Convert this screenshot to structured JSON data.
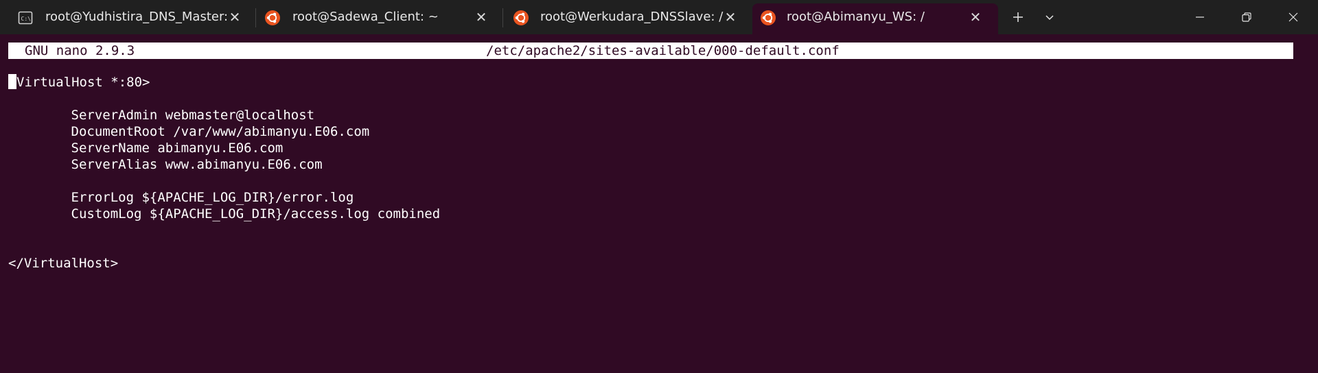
{
  "tabs": [
    {
      "title": "root@Yudhistira_DNS_Master:",
      "icon": "cmd-icon",
      "active": false
    },
    {
      "title": "root@Sadewa_Client: ~",
      "icon": "ubuntu-icon",
      "active": false
    },
    {
      "title": "root@Werkudara_DNSSlave: /",
      "icon": "ubuntu-icon",
      "active": false
    },
    {
      "title": "root@Abimanyu_WS: /",
      "icon": "ubuntu-icon",
      "active": true
    }
  ],
  "tabbar_controls": {
    "new_tab": "+",
    "dropdown": "chevron-down-icon"
  },
  "window_controls": [
    "minimize-icon",
    "restore-icon",
    "close-icon"
  ],
  "nano": {
    "version": "GNU nano 2.9.3",
    "filename": "/etc/apache2/sites-available/000-default.conf"
  },
  "file_lines": [
    "VirtualHost *:80>",
    "",
    "        ServerAdmin webmaster@localhost",
    "        DocumentRoot /var/www/abimanyu.E06.com",
    "        ServerName abimanyu.E06.com",
    "        ServerAlias www.abimanyu.E06.com",
    "",
    "        ErrorLog ${APACHE_LOG_DIR}/error.log",
    "        CustomLog ${APACHE_LOG_DIR}/access.log combined",
    "",
    "",
    "</VirtualHost>"
  ],
  "colors": {
    "terminal_bg": "#300a24",
    "tabbar_bg": "#202020",
    "ubuntu_orange": "#e95420",
    "text": "#ffffff"
  }
}
